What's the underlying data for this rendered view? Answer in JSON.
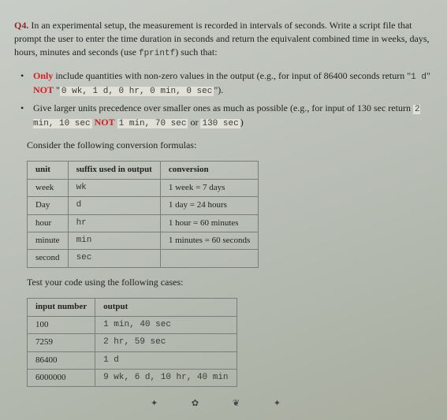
{
  "question": {
    "number": "Q4.",
    "text_part1": "In an experimental setup, the measurement is recorded in intervals of seconds. Write a script file that prompt the user to enter the time duration in seconds and return the equivalent combined time in weeks, days, hours, minutes and seconds (use ",
    "code_inline": "fprintf",
    "text_part2": ") such that:"
  },
  "bullets": {
    "b1": {
      "only": "Only",
      "text1": " include quantities with non-zero values in the output (e.g., for input of 86400 seconds return \"",
      "code_a": "1 d",
      "quote": "\" ",
      "not": "NOT",
      "space": " \"",
      "code_b": "0 wk, 1 d, 0 hr, 0 min, 0 sec",
      "text2": "\")."
    },
    "b2": {
      "text1": "Give larger units precedence over smaller ones as much as possible (e.g., for input of 130 sec return ",
      "code_a": "2 min, 10 sec",
      "space1": " ",
      "not": "NOT",
      "space2": " ",
      "code_b": "1 min, 70 sec",
      "or": " or ",
      "code_c": "130 sec",
      "text2": ")"
    }
  },
  "consider": "Consider the following conversion formulas:",
  "table1": {
    "h1": "unit",
    "h2": "suffix used in output",
    "h3": "conversion",
    "r1c1": "week",
    "r1c2": "wk",
    "r1c3": "1 week = 7 days",
    "r2c1": "Day",
    "r2c2": "d",
    "r2c3": "1 day = 24 hours",
    "r3c1": "hour",
    "r3c2": "hr",
    "r3c3": "1 hour = 60 minutes",
    "r4c1": "minute",
    "r4c2": "min",
    "r4c3": "1 minutes = 60 seconds",
    "r5c1": "second",
    "r5c2": "sec"
  },
  "testhead": "Test your code using the following cases:",
  "table2": {
    "h1": "input number",
    "h2": "output",
    "r1c1": "100",
    "r1c2": "1 min, 40 sec",
    "r2c1": "7259",
    "r2c2": "2 hr, 59 sec",
    "r3c1": "86400",
    "r3c2": "1 d",
    "r4c1": "6000000",
    "r4c2": "9 wk, 6 d, 10 hr, 40 min"
  }
}
